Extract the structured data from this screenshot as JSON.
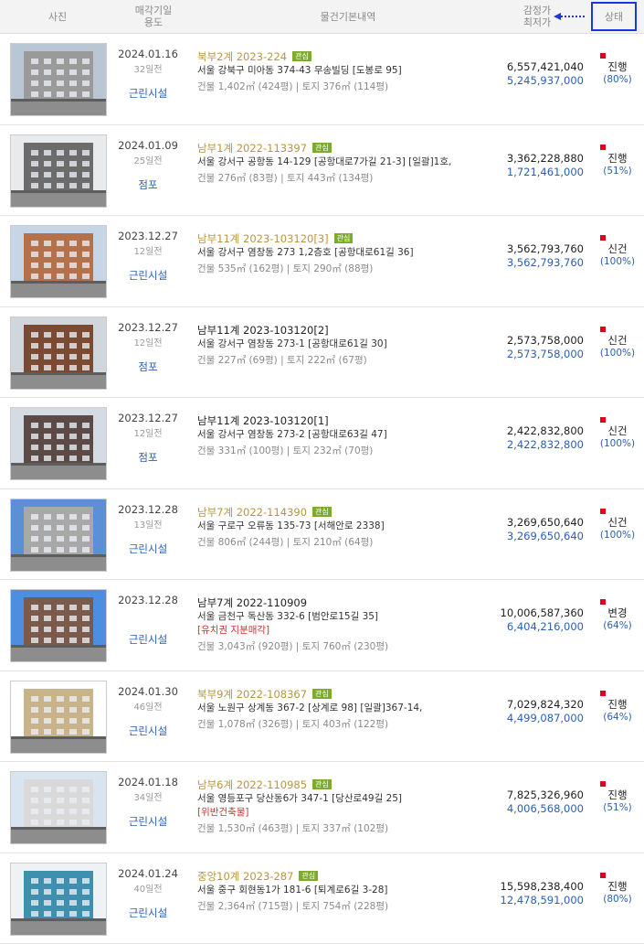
{
  "header": {
    "photo": "사진",
    "date_line1": "매각기일",
    "date_line2": "용도",
    "info": "물건기본내역",
    "price_line1": "감정가",
    "price_line2": "최저가",
    "status": "상태"
  },
  "rows": [
    {
      "date": "2024.01.16",
      "days": "32일전",
      "usage": "근린시설",
      "case": "북부2계 2023-224",
      "badge": "관심",
      "addr": "서울 강북구 미아동 374-43 무송빌딩 [도봉로 95]",
      "warn": "",
      "area": "건물 1,402㎡ (424평)  |  토지 376㎡ (114평)",
      "appraisal": "6,557,421,040",
      "minimum": "5,245,937,000",
      "status": "진행",
      "percent": "(80%)"
    },
    {
      "date": "2024.01.09",
      "days": "25일전",
      "usage": "점포",
      "case": "남부1계 2022-113397",
      "badge": "관심",
      "addr": "서울 강서구 공항동 14-129 [공항대로7가길 21-3]  [일괄]1호,",
      "warn": "",
      "area": "건물 276㎡ (83평)  |  토지 443㎡ (134평)",
      "appraisal": "3,362,228,880",
      "minimum": "1,721,461,000",
      "status": "진행",
      "percent": "(51%)"
    },
    {
      "date": "2023.12.27",
      "days": "12일전",
      "usage": "근린시설",
      "case": "남부11계 2023-103120[3]",
      "badge": "관심",
      "addr": "서울 강서구 염창동 273 1,2층호 [공항대로61길 36]",
      "warn": "",
      "area": "건물 535㎡ (162평)  |  토지 290㎡ (88평)",
      "appraisal": "3,562,793,760",
      "minimum": "3,562,793,760",
      "status": "신건",
      "percent": "(100%)"
    },
    {
      "date": "2023.12.27",
      "days": "12일전",
      "usage": "점포",
      "case": "남부11계 2023-103120[2]",
      "badge": "",
      "addr": "서울 강서구 염창동 273-1 [공항대로61길 30]",
      "warn": "",
      "area": "건물 227㎡ (69평)  |  토지 222㎡ (67평)",
      "appraisal": "2,573,758,000",
      "minimum": "2,573,758,000",
      "status": "신건",
      "percent": "(100%)"
    },
    {
      "date": "2023.12.27",
      "days": "12일전",
      "usage": "점포",
      "case": "남부11계 2023-103120[1]",
      "badge": "",
      "addr": "서울 강서구 염창동 273-2 [공항대로63길 47]",
      "warn": "",
      "area": "건물 331㎡ (100평)  |  토지 232㎡ (70평)",
      "appraisal": "2,422,832,800",
      "minimum": "2,422,832,800",
      "status": "신건",
      "percent": "(100%)"
    },
    {
      "date": "2023.12.28",
      "days": "13일전",
      "usage": "근린시설",
      "case": "남부7계 2022-114390",
      "badge": "관심",
      "addr": "서울 구로구 오류동 135-73 [서해안로 2338]",
      "warn": "",
      "area": "건물 806㎡ (244평)  |  토지 210㎡ (64평)",
      "appraisal": "3,269,650,640",
      "minimum": "3,269,650,640",
      "status": "신건",
      "percent": "(100%)"
    },
    {
      "date": "2023.12.28",
      "days": "",
      "usage": "근린시설",
      "case": "남부7계 2022-110909",
      "badge": "",
      "addr": "서울 금천구 독산동 332-6 [범안로15길 35]",
      "warn": "[유치권  지분매각]",
      "area": "건물 3,043㎡ (920평)  |  토지 760㎡ (230평)",
      "appraisal": "10,006,587,360",
      "minimum": "6,404,216,000",
      "status": "변경",
      "percent": "(64%)"
    },
    {
      "date": "2024.01.30",
      "days": "46일전",
      "usage": "근린시설",
      "case": "북부9계 2022-108367",
      "badge": "관심",
      "addr": "서울 노원구 상계동 367-2 [상계로 98]  [일괄]367-14,",
      "warn": "",
      "area": "건물 1,078㎡ (326평)  |  토지 403㎡ (122평)",
      "appraisal": "7,029,824,320",
      "minimum": "4,499,087,000",
      "status": "진행",
      "percent": "(64%)"
    },
    {
      "date": "2024.01.18",
      "days": "34일전",
      "usage": "근린시설",
      "case": "남부6계 2022-110985",
      "badge": "관심",
      "addr": "서울 영등포구 당산동6가 347-1 [당산로49길 25]",
      "warn": "[위반건축물]",
      "area": "건물 1,530㎡ (463평)  |  토지 337㎡ (102평)",
      "appraisal": "7,825,326,960",
      "minimum": "4,006,568,000",
      "status": "진행",
      "percent": "(51%)"
    },
    {
      "date": "2024.01.24",
      "days": "40일전",
      "usage": "근린시설",
      "case": "중앙10계 2023-287",
      "badge": "관심",
      "addr": "서울 중구 회현동1가 181-6 [퇴계로6길 3-28]",
      "warn": "",
      "area": "건물 2,364㎡ (715평)  |  토지 754㎡ (228평)",
      "appraisal": "15,598,238,400",
      "minimum": "12,478,591,000",
      "status": "진행",
      "percent": "(80%)"
    }
  ]
}
